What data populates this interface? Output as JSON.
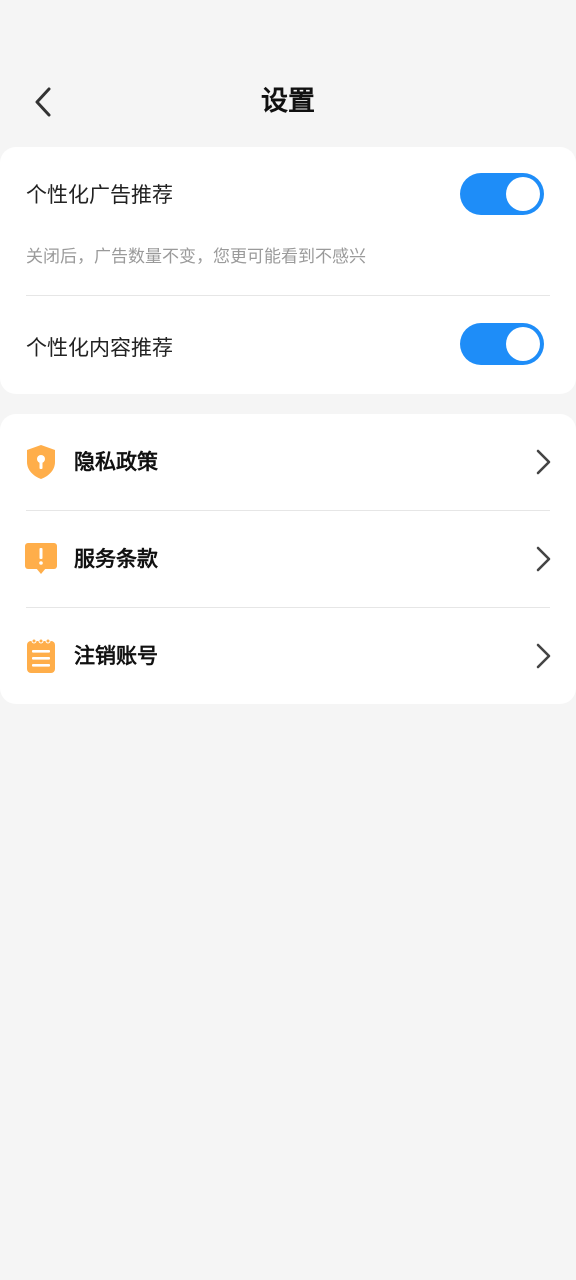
{
  "header": {
    "title": "设置",
    "back_icon": "chevron-left-icon"
  },
  "toggles": [
    {
      "label": "个性化广告推荐",
      "description": "关闭后，广告数量不变，您更可能看到不感兴",
      "enabled": true
    },
    {
      "label": "个性化内容推荐",
      "enabled": true
    }
  ],
  "links": [
    {
      "label": "隐私政策",
      "icon": "shield-icon"
    },
    {
      "label": "服务条款",
      "icon": "alert-icon"
    },
    {
      "label": "注销账号",
      "icon": "clipboard-icon"
    }
  ],
  "colors": {
    "accent": "#1e8df8",
    "icon": "#ffae4a",
    "background": "#f5f5f5"
  }
}
